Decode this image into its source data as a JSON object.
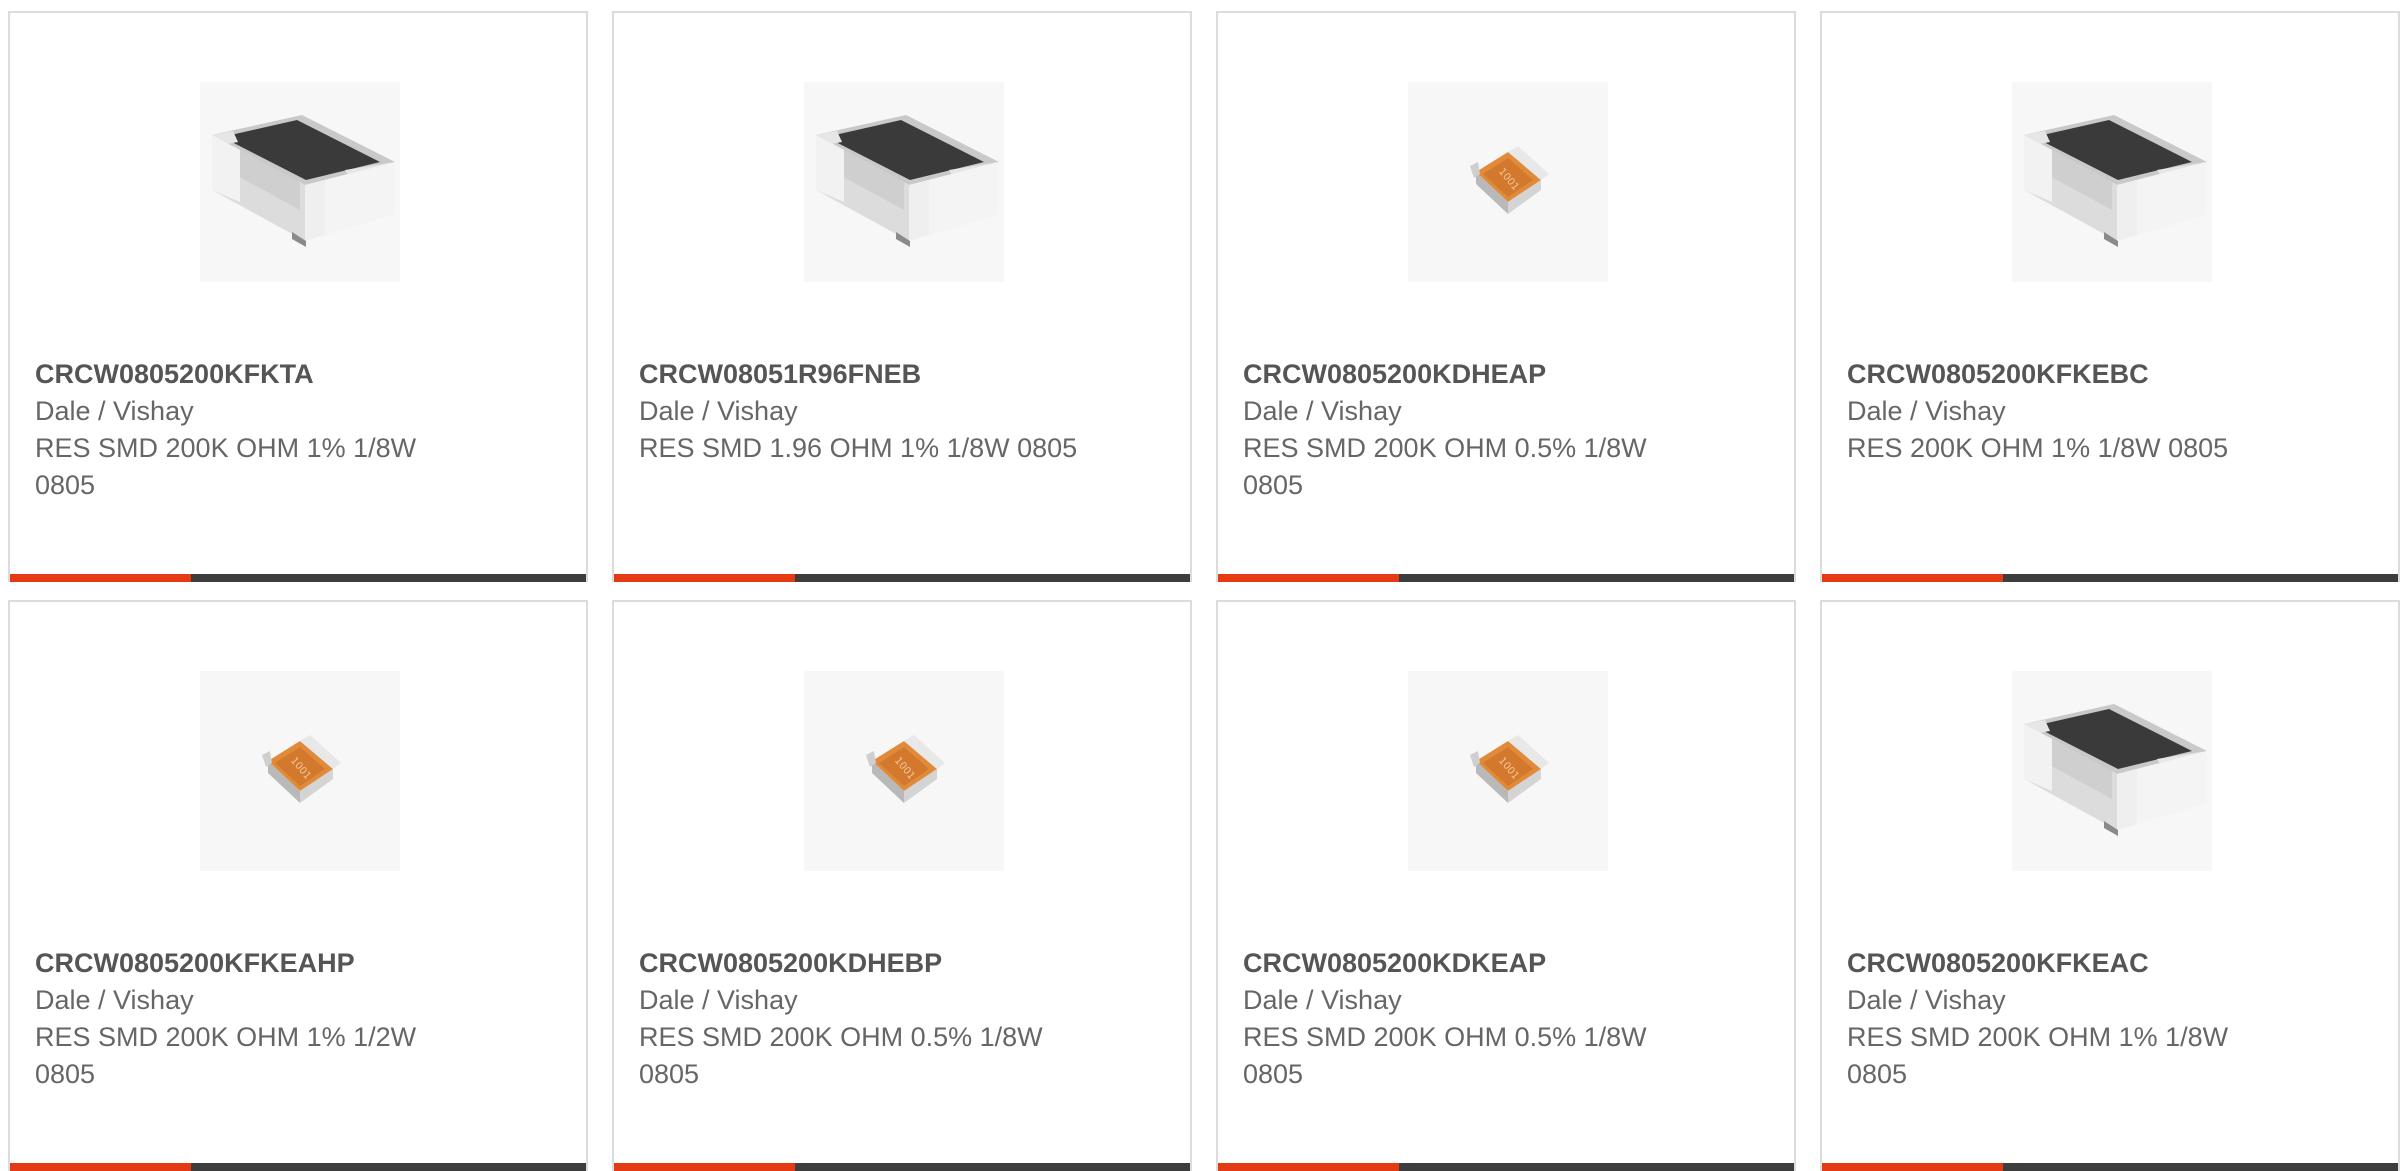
{
  "colors": {
    "accent": "#e53b14",
    "bar_track": "#3d3d3d",
    "card_border": "#dcdcdc",
    "text": "#666666"
  },
  "cards": [
    {
      "part_number": "CRCW0805200KFKTA",
      "manufacturer": "Dale / Vishay",
      "description": "RES SMD 200K OHM 1% 1/8W 0805",
      "image_icon": "black-resistor-chip-icon",
      "accent_fraction": 0.315
    },
    {
      "part_number": "CRCW08051R96FNEB",
      "manufacturer": "Dale / Vishay",
      "description": "RES SMD 1.96 OHM 1% 1/8W 0805",
      "image_icon": "black-resistor-chip-icon",
      "accent_fraction": 0.315
    },
    {
      "part_number": "CRCW0805200KDHEAP",
      "manufacturer": "Dale / Vishay",
      "description": "RES SMD 200K OHM 0.5% 1/8W 0805",
      "image_icon": "orange-resistor-chip-icon",
      "accent_fraction": 0.315
    },
    {
      "part_number": "CRCW0805200KFKEBC",
      "manufacturer": "Dale / Vishay",
      "description": "RES 200K OHM 1% 1/8W 0805",
      "image_icon": "black-resistor-chip-icon",
      "accent_fraction": 0.315
    },
    {
      "part_number": "CRCW0805200KFKEAHP",
      "manufacturer": "Dale / Vishay",
      "description": "RES SMD 200K OHM 1% 1/2W 0805",
      "image_icon": "orange-resistor-chip-icon",
      "accent_fraction": 0.315
    },
    {
      "part_number": "CRCW0805200KDHEBP",
      "manufacturer": "Dale / Vishay",
      "description": "RES SMD 200K OHM 0.5% 1/8W 0805",
      "image_icon": "orange-resistor-chip-icon",
      "accent_fraction": 0.315
    },
    {
      "part_number": "CRCW0805200KDKEAP",
      "manufacturer": "Dale / Vishay",
      "description": "RES SMD 200K OHM 0.5% 1/8W 0805",
      "image_icon": "orange-resistor-chip-icon",
      "accent_fraction": 0.315
    },
    {
      "part_number": "CRCW0805200KFKEAC",
      "manufacturer": "Dale / Vishay",
      "description": "RES SMD 200K OHM 1% 1/8W 0805",
      "image_icon": "black-resistor-chip-icon",
      "accent_fraction": 0.315
    }
  ]
}
